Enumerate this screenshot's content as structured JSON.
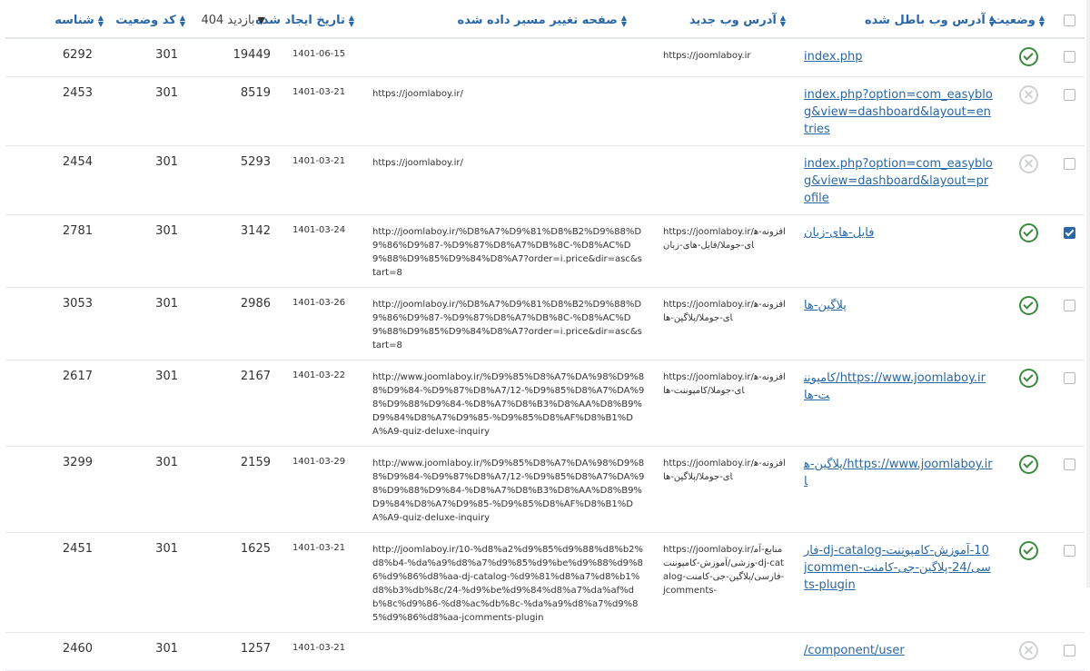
{
  "columns": {
    "status": "وضعیت",
    "old_url": "آدرس وب باطل شده",
    "new_url": "آدرس وب جدید",
    "referrer": "صفحه تغییر مسیر داده شده",
    "created": "تاریخ ایجاد شده",
    "hits": "بازدید 404",
    "code": "کد وضعیت",
    "id": "شناسه"
  },
  "rows": [
    {
      "checked": false,
      "status": "enabled",
      "old_url": "index.php",
      "new_url": "https://joomlaboy.ir",
      "referrer": "",
      "created": "1401-06-15",
      "hits": "19449",
      "code": "301",
      "id": "6292"
    },
    {
      "checked": false,
      "status": "disabled",
      "old_url": "index.php?option=com_easyblog&view=dashboard&layout=entries",
      "new_url": "",
      "referrer": "https://joomlaboy.ir/",
      "created": "1401-03-21",
      "hits": "8519",
      "code": "301",
      "id": "2453"
    },
    {
      "checked": false,
      "status": "disabled",
      "old_url": "index.php?option=com_easyblog&view=dashboard&layout=profile",
      "new_url": "",
      "referrer": "https://joomlaboy.ir/",
      "created": "1401-03-21",
      "hits": "5293",
      "code": "301",
      "id": "2454"
    },
    {
      "checked": true,
      "status": "enabled",
      "old_url": "فایل-های-زبان",
      "new_url": "https://joomlaboy.ir/افزونه-های-جوملا/فایل-های-زبان",
      "referrer": "http://joomlaboy.ir/%D8%A7%D9%81%D8%B2%D9%88%D9%86%D9%87-%D9%87%D8%A7%DB%8C-%D8%AC%D9%88%D9%85%D9%84%D8%A7?order=i.price&dir=asc&start=8",
      "created": "1401-03-24",
      "hits": "3142",
      "code": "301",
      "id": "2781"
    },
    {
      "checked": false,
      "status": "enabled",
      "old_url": "پلاگین-ها",
      "new_url": "https://joomlaboy.ir/افزونه-های-جوملا/پلاگین-ها",
      "referrer": "http://joomlaboy.ir/%D8%A7%D9%81%D8%B2%D9%88%D9%86%D9%87-%D9%87%D8%A7%DB%8C-%D8%AC%D9%88%D9%85%D9%84%D8%A7?order=i.price&dir=asc&start=8",
      "created": "1401-03-26",
      "hits": "2986",
      "code": "301",
      "id": "3053"
    },
    {
      "checked": false,
      "status": "enabled",
      "old_url": "https://www.joomlaboy.ir/کامپوننت-ها",
      "new_url": "https://joomlaboy.ir/افزونه-های-جوملا/کامپوننت-ها",
      "referrer": "http://www.joomlaboy.ir/%D9%85%D8%A7%DA%98%D9%88%D9%84-%D9%87%D8%A7/12-%D9%85%D8%A7%DA%98%D9%88%D9%84-%D8%A7%D8%B3%D8%AA%D8%B9%D9%84%D8%A7%D9%85-%D9%85%D8%AF%D8%B1%DA%A9-quiz-deluxe-inquiry",
      "created": "1401-03-22",
      "hits": "2167",
      "code": "301",
      "id": "2617"
    },
    {
      "checked": false,
      "status": "enabled",
      "old_url": "https://www.joomlaboy.ir/پلاگین-ها",
      "new_url": "https://joomlaboy.ir/افزونه-های-جوملا/پلاگین-ها",
      "referrer": "http://www.joomlaboy.ir/%D9%85%D8%A7%DA%98%D9%88%D9%84-%D9%87%D8%A7/12-%D9%85%D8%A7%DA%98%D9%88%D9%84-%D8%A7%D8%B3%D8%AA%D8%B9%D9%84%D8%A7%D9%85-%D9%85%D8%AF%D8%B1%DA%A9-quiz-deluxe-inquiry",
      "created": "1401-03-29",
      "hits": "2159",
      "code": "301",
      "id": "3299"
    },
    {
      "checked": false,
      "status": "enabled",
      "old_url": "10-آموزش-کامپوننت-dj-catalog-فارسی/24-پلاگین-جی-کامنت-jcomments-plugin",
      "new_url": "https://joomlaboy.ir/منابع-آموزشی/آموزش-کامپوننت-dj-catalog-فارسی/پلاگین-جی-کامنت-jcomments-",
      "referrer": "http://joomlaboy.ir/10-%d8%a2%d9%85%d9%88%d8%b2%d8%b4-%da%a9%d8%a7%d9%85%d9%be%d9%88%d9%86%d9%86%d8%aa-dj-catalog-%d9%81%d8%a7%d8%b1%d8%b3%db%8c/24-%d9%be%d9%84%d8%a7%da%af%db%8c%d9%86-%d8%ac%db%8c-%da%a9%d8%a7%d9%85%d9%86%d8%aa-jcomments-plugin",
      "created": "1401-03-21",
      "hits": "1625",
      "code": "301",
      "id": "2451"
    },
    {
      "checked": false,
      "status": "disabled",
      "old_url": "component/user/",
      "new_url": "",
      "referrer": "",
      "created": "1401-03-21",
      "hits": "1257",
      "code": "301",
      "id": "2460"
    }
  ]
}
